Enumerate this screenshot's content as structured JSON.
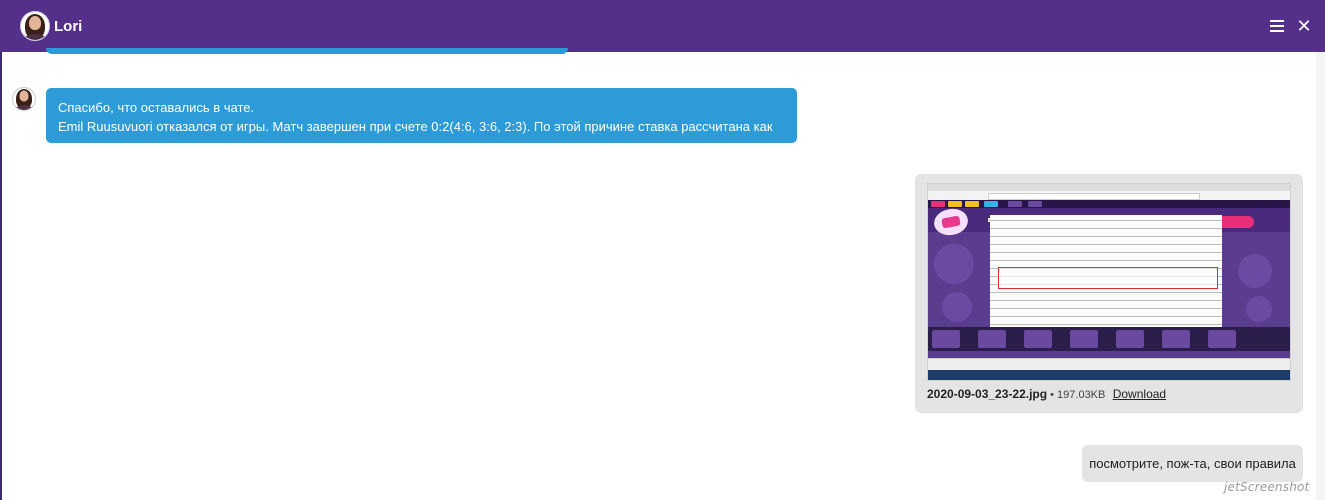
{
  "header": {
    "agent_name": "Lori",
    "background_color": "#54308a",
    "menu_icon": "hamburger-menu-icon",
    "close_icon": "close-icon"
  },
  "messages": {
    "agent_line1": "Спасибо, что оставались в чате.",
    "agent_player": "Emil Ruusuvuori",
    "agent_line2_rest": " отказался от игры. Матч завершен при счете 0:2(4:6, 3:6, 2:3). По этой причине ставка рассчитана как возврат.",
    "agent_bubble_color": "#2c9bd8",
    "attachment": {
      "file_name": "2020-09-03_23-22.jpg",
      "file_size": " • 197.03KB",
      "download_label": "Download"
    },
    "user_text": "посмотрите, пож-та, свои правила",
    "user_bubble_color": "#e4e4e4"
  },
  "watermark": "jetScreenshot"
}
